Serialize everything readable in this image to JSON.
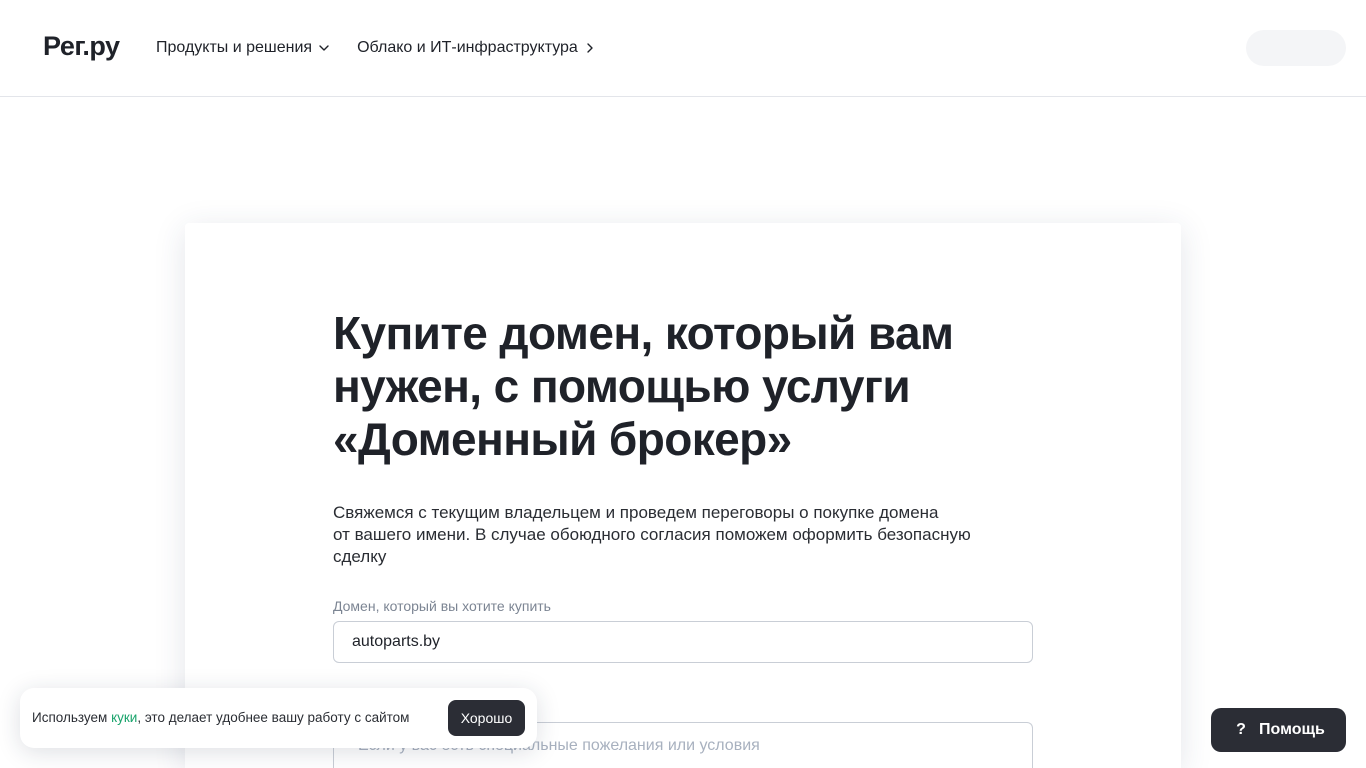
{
  "header": {
    "logo": "Рег.ру",
    "nav": [
      {
        "label": "Продукты и решения",
        "icon": "chevron-down-icon"
      },
      {
        "label": "Облако и ИТ-инфраструктура",
        "icon": "chevron-right-icon"
      }
    ]
  },
  "hero": {
    "title_lines": [
      "Купите домен, который вам",
      "нужен, с помощью услуги",
      "«Доменный брокер»"
    ],
    "description_lines": [
      "Свяжемся с текущим владельцем и проведем переговоры о покупке домена",
      "от вашего имени. В случае обоюдного согласия поможем оформить безопасную",
      "сделку"
    ]
  },
  "form": {
    "domain_label": "Домен, который вы хотите купить",
    "domain_value": "autoparts.by",
    "wishes_placeholder": "Если у вас есть специальные пожелания или условия"
  },
  "cookie_banner": {
    "text_prefix": "Используем ",
    "link_label": "куки",
    "text_suffix": ", это делает удобнее вашу работу с сайтом",
    "accept_label": "Хорошо"
  },
  "help": {
    "icon_glyph": "?",
    "label": "Помощь"
  },
  "colors": {
    "accent": "#1aa46c",
    "dark": "#2b2d35"
  }
}
